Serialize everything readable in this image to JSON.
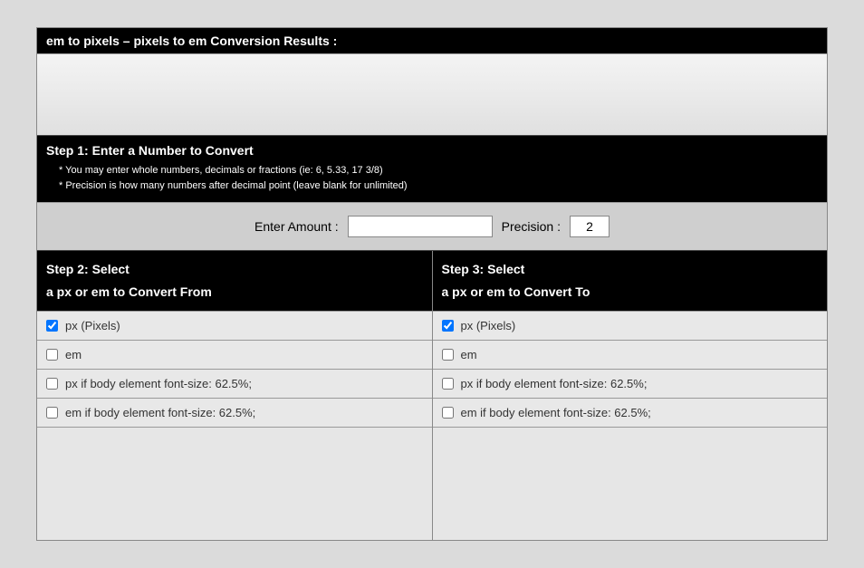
{
  "title": "em to pixels – pixels to em Conversion Results :",
  "step1": {
    "heading": "Step 1: Enter a Number to Convert",
    "note1": "* You may enter whole numbers, decimals or fractions (ie: 6, 5.33, 17 3/8)",
    "note2": "* Precision is how many numbers after decimal point (leave blank for unlimited)"
  },
  "inputs": {
    "amount_label": "Enter Amount :",
    "amount_value": "",
    "precision_label": "Precision :",
    "precision_value": "2"
  },
  "step2": {
    "heading_line1": "Step 2: Select",
    "heading_line2": "a px or em to Convert From"
  },
  "step3": {
    "heading_line1": "Step 3: Select",
    "heading_line2": "a px or em to Convert To"
  },
  "options": [
    {
      "label": "px (Pixels)",
      "checked": true
    },
    {
      "label": "em",
      "checked": false
    },
    {
      "label": "px if body element font-size: 62.5%;",
      "checked": false
    },
    {
      "label": "em if body element font-size: 62.5%;",
      "checked": false
    }
  ]
}
